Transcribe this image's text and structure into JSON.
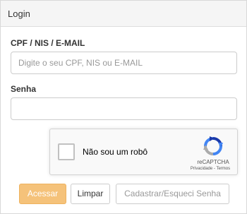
{
  "header": {
    "title": "Login"
  },
  "form": {
    "cpf_label": "CPF / NIS / E-MAIL",
    "cpf_placeholder": "Digite o seu CPF, NIS ou E-MAIL",
    "cpf_value": "",
    "password_label": "Senha",
    "password_value": ""
  },
  "recaptcha": {
    "checkbox_label": "Não sou um robô",
    "checked": false,
    "brand": "reCAPTCHA",
    "privacy_link": "Privacidade",
    "separator": " - ",
    "terms_link": "Termos",
    "icon": "recaptcha-logo"
  },
  "buttons": {
    "submit_label": "Acessar",
    "clear_label": "Limpar",
    "register_label": "Cadastrar/Esqueci Senha"
  },
  "colors": {
    "primary_button": "#f5c27a",
    "header_background": "#f5f5f5",
    "border": "#cccccc"
  }
}
